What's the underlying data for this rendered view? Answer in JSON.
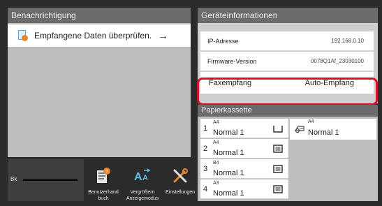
{
  "notifications": {
    "title": "Benachrichtigung",
    "items": [
      {
        "label": "Empfangene Daten überprüfen.",
        "icon": "document-notification-icon"
      }
    ]
  },
  "status_bar": {
    "toner_label": "Bk",
    "toner_level": 1.0
  },
  "shortcuts": [
    {
      "label_line1": "Benutzerhand",
      "label_line2": "buch",
      "icon": "manual-icon"
    },
    {
      "label_line1": "Vergrößern",
      "label_line2": "Anzeigemodus",
      "icon": "zoom-text-icon"
    },
    {
      "label_line1": "Einstellungen",
      "label_line2": "",
      "icon": "tools-icon"
    }
  ],
  "device_info": {
    "title": "Geräteinformationen",
    "rows": [
      {
        "key": "IP-Adresse",
        "value": "192.168.0.10"
      },
      {
        "key": "Firmware-Version",
        "value": "0078Q1Af_23030100"
      },
      {
        "key": "Faxempfang",
        "value": "Auto-Empfang"
      }
    ]
  },
  "paper_trays": {
    "title": "Papierkassette",
    "trays": [
      {
        "number": "1",
        "size": "A4",
        "type": "Normal 1"
      },
      {
        "number": "2",
        "size": "A4",
        "type": "Normal 1"
      },
      {
        "number": "3",
        "size": "B4",
        "type": "Normal 1"
      },
      {
        "number": "4",
        "size": "A3",
        "type": "Normal 1"
      }
    ],
    "bypass": {
      "size": "A4",
      "type": "Normal 1"
    }
  },
  "colors": {
    "highlight": "#d8102a",
    "panel_header": "#6b6b6b",
    "accent_orange": "#e8862a"
  }
}
